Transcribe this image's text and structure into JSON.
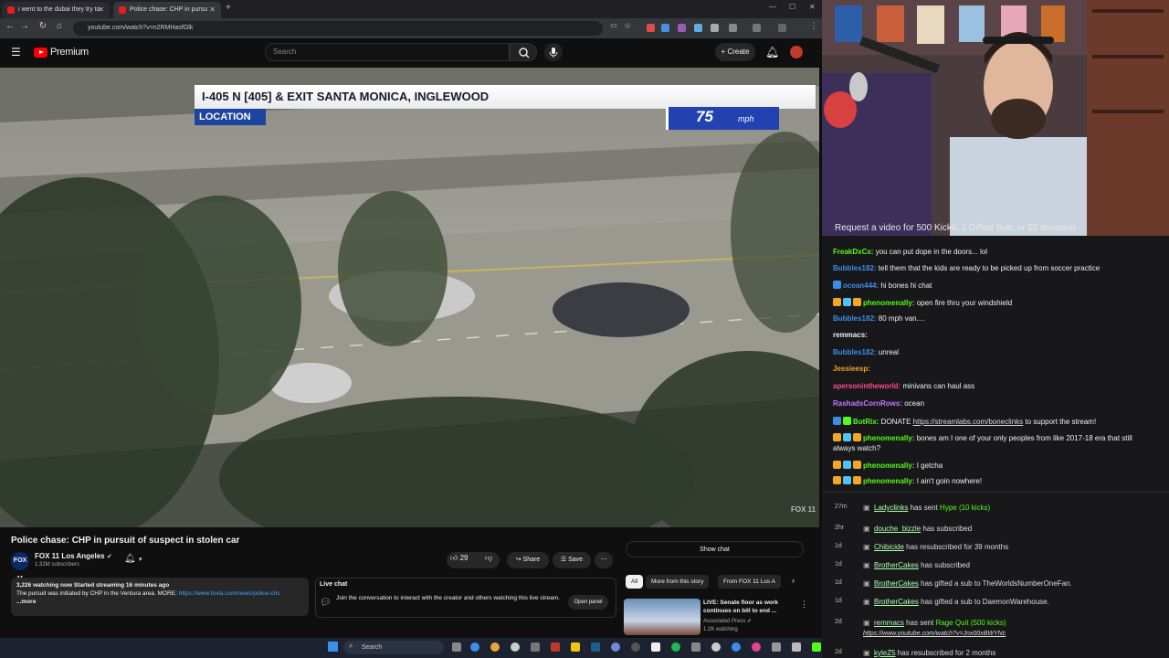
{
  "browser": {
    "tabs": [
      {
        "title": "i went to the dubai they try to",
        "active": false
      },
      {
        "title": "Police chase: CHP in pursu",
        "active": true
      }
    ],
    "url": "youtube.com/watch?v=n2RMHasfGlk"
  },
  "youtube": {
    "brand": "Premium",
    "search_placeholder": "Search",
    "create_label": "Create",
    "video": {
      "location_line": "I-405 N [405] & EXIT SANTA MONICA, INGLEWOOD",
      "location_tag": "LOCATION",
      "speed": "75",
      "speed_unit": "mph",
      "watermark": "FOX 11"
    },
    "title": "Police chase: CHP in pursuit of suspect in stolen car",
    "channel": {
      "name": "FOX 11 Los Angeles",
      "subs": "1.32M subscribers",
      "avatar_text": "FOX 11"
    },
    "likes": "29",
    "share_label": "Share",
    "save_label": "Save",
    "description": {
      "stats": "3,226 watching now  Started streaming 16 minutes ago",
      "text": "The pursuit was initiated by CHP in the Ventura area. MORE:",
      "link": "https://www.foxla.com/news/police-chs",
      "more": "...more"
    },
    "live_chat": {
      "title": "Live chat",
      "text": "Join the conversation to interact with the creator and others watching this live stream.",
      "button": "Open panel"
    },
    "show_chat": "Show chat",
    "chips": [
      "All",
      "More from this story",
      "From FOX 11 Los A"
    ],
    "related": {
      "title": "LIVE: Senate floor as work continues on bill to end ...",
      "channel": "Associated Press",
      "views": "1.2K watching"
    }
  },
  "taskbar": {
    "search": "Search"
  },
  "stream": {
    "overlay_text": "Request a video for 500 Kicks, 1 Gifted Sub, or $5 donation."
  },
  "chat": [
    {
      "user": "FreakDxCx",
      "color": "#53fc18",
      "badges": [],
      "text": "you can put dope in the doors... lol"
    },
    {
      "user": "Bubbles182",
      "color": "#3b8eea",
      "badges": [],
      "text": "tell them that the kids are ready to be picked up from soccer practice"
    },
    {
      "user": "ocean444",
      "color": "#3b8eea",
      "badges": [
        "#3b8eea"
      ],
      "text": "hi bones hi chat"
    },
    {
      "user": "phenomenally",
      "color": "#53fc18",
      "badges": [
        "#f5a623",
        "#4fc3f7",
        "#f5a623"
      ],
      "text": "open fire thru your windshield"
    },
    {
      "user": "Bubbles182",
      "color": "#3b8eea",
      "badges": [],
      "text": "80 mph van...."
    },
    {
      "user": "remmacs",
      "color": "#f0f0f0",
      "badges": [],
      "text": ""
    },
    {
      "user": "Bubbles182",
      "color": "#3b8eea",
      "badges": [],
      "text": "unreal"
    },
    {
      "user": "Jessieesp",
      "color": "#f5a623",
      "badges": [],
      "text": ""
    },
    {
      "user": "apersonintheworld",
      "color": "#ff4b8b",
      "badges": [],
      "text": "minivans can haul ass"
    },
    {
      "user": "RashadsCornRows",
      "color": "#c878ff",
      "badges": [],
      "text": "ocean"
    },
    {
      "user": "BotRix",
      "color": "#53fc18",
      "badges": [
        "#3b8eea",
        "#53fc18"
      ],
      "text": "DONATE ",
      "link": "https://streamlabs.com/boneclinks",
      "after": " to support the stream!"
    },
    {
      "user": "phenomenally",
      "color": "#53fc18",
      "badges": [
        "#f5a623",
        "#4fc3f7",
        "#f5a623"
      ],
      "text": "bones am I one of your only peoples from like 2017-18 era that still",
      "cont": "always watch?"
    },
    {
      "user": "phenomenally",
      "color": "#53fc18",
      "badges": [
        "#f5a623",
        "#4fc3f7",
        "#f5a623"
      ],
      "text": "I getcha"
    },
    {
      "user": "phenomenally",
      "color": "#53fc18",
      "badges": [
        "#f5a623",
        "#4fc3f7",
        "#f5a623"
      ],
      "text": "I ain't goin nowhere!"
    }
  ],
  "events": [
    {
      "time": "27m",
      "name": "Ladyclinks",
      "action": "has sent ",
      "extra": "Hype (10 kicks)"
    },
    {
      "time": "2hr",
      "name": "douche_bizzle",
      "action": "has subscribed",
      "extra": ""
    },
    {
      "time": "1d",
      "name": "Chibicide",
      "action": "has resubscribed for 39 months",
      "extra": ""
    },
    {
      "time": "1d",
      "name": "BrotherCakes",
      "action": "has subscribed",
      "extra": ""
    },
    {
      "time": "1d",
      "name": "BrotherCakes",
      "action": "has gifted a sub to TheWorldsNumberOneFan.",
      "extra": ""
    },
    {
      "time": "1d",
      "name": "BrotherCakes",
      "action": "has gifted a sub to DaemonWarehouse.",
      "extra": ""
    },
    {
      "time": "2d",
      "name": "remmacs",
      "action": "has sent ",
      "extra": "Rage Quit (500 kicks)",
      "sub": "https://www.youtube.com/watch?v=Jnx00xBWYNc"
    },
    {
      "time": "2d",
      "name": "kyleZ5",
      "action": "has resubscribed for 2 months",
      "extra": ""
    }
  ]
}
